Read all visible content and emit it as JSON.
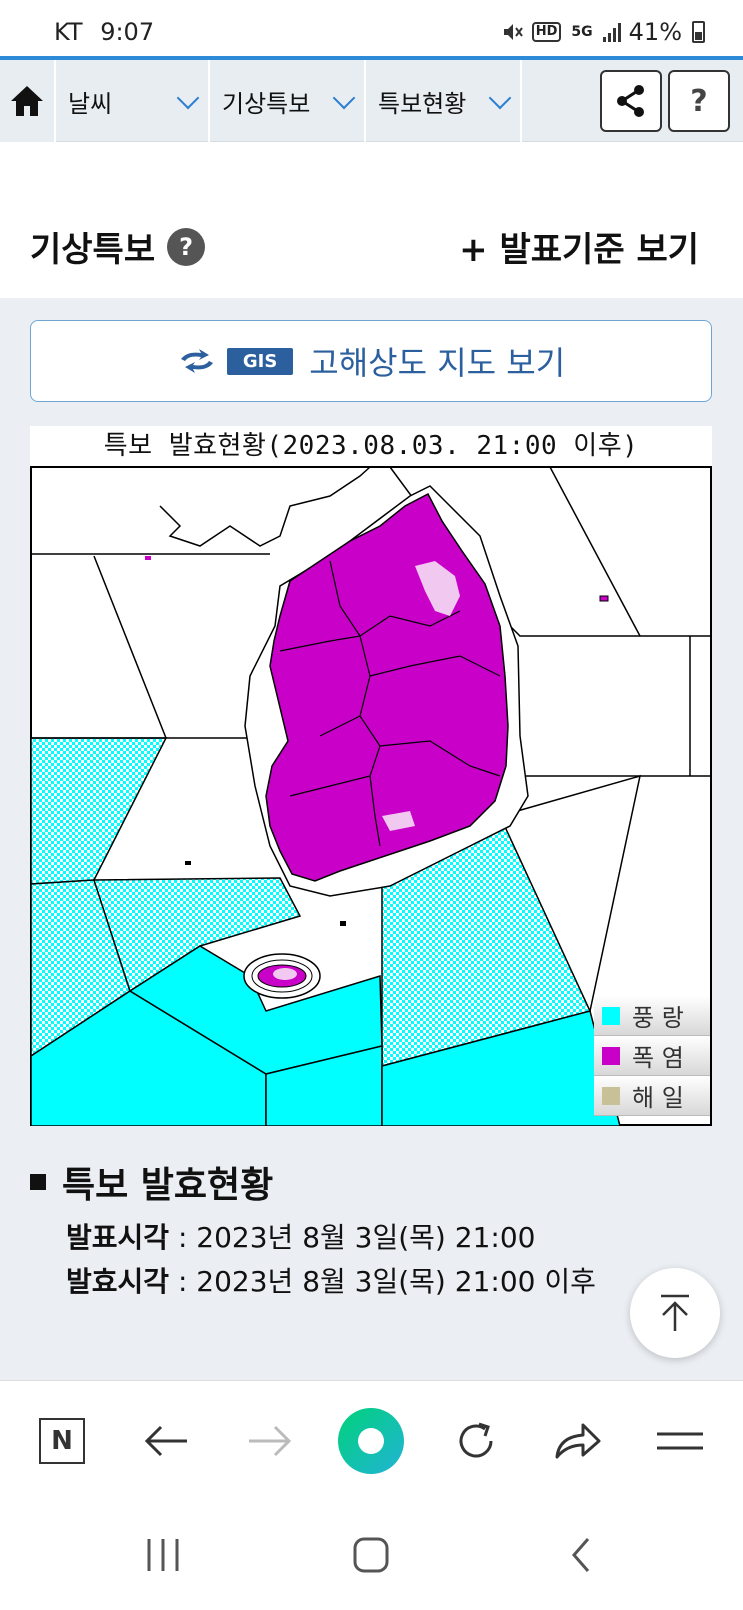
{
  "status_bar": {
    "carrier": "KT",
    "time": "9:07",
    "hd_badge": "HD",
    "network_badge": "5G",
    "battery": "41%"
  },
  "nav": {
    "dropdowns": [
      {
        "label": "날씨"
      },
      {
        "label": "기상특보"
      },
      {
        "label": "특보현황"
      }
    ],
    "help_label": "?"
  },
  "header": {
    "title": "기상특보",
    "help_label": "?",
    "criteria_link": "+ 발표기준 보기"
  },
  "gis_button": {
    "tag": "GIS",
    "label": "고해상도 지도 보기"
  },
  "map": {
    "title": "특보 발효현황(2023.08.03. 21:00 이후)",
    "legend": [
      {
        "label": "풍 랑",
        "color": "#00ffff"
      },
      {
        "label": "폭 염",
        "color": "#c800c8"
      },
      {
        "label": "해 일",
        "color": "#c8c096"
      }
    ]
  },
  "status_section": {
    "title": "특보 발효현황",
    "rows": [
      {
        "label": "발표시각",
        "value": " : 2023년 8월 3일(목) 21:00"
      },
      {
        "label": "발효시각",
        "value": " : 2023년 8월 3일(목) 21:00 이후"
      }
    ]
  },
  "browser_toolbar": {
    "naver_label": "N"
  },
  "colors": {
    "accent": "#2d8ad7",
    "gis_blue": "#2c5f9e",
    "wave_warning": "#00ffff",
    "heat_warning": "#c800c8",
    "page_bg": "#ebeff3"
  }
}
